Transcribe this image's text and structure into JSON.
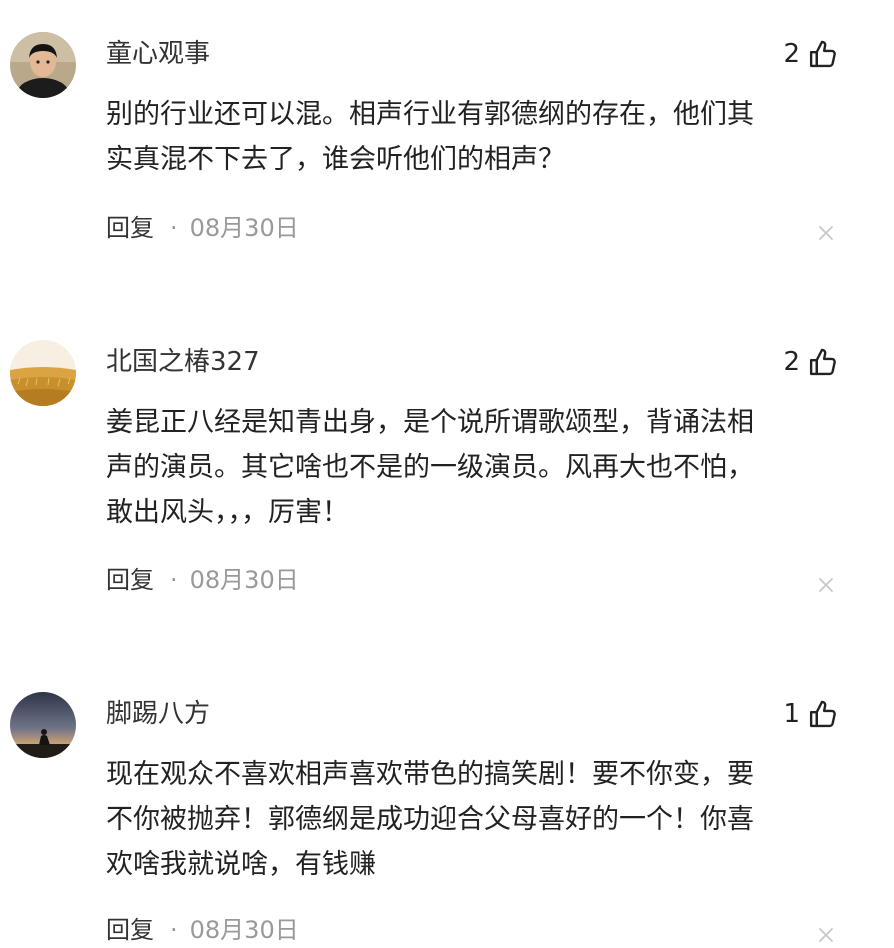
{
  "comments": [
    {
      "username": "童心观事",
      "likes": "2",
      "text_lines": [
        "别的行业还可以混。相声行业有郭德纲的存在，他们其",
        "实真混不下去了，谁会听他们的相声？"
      ],
      "reply_label": "回复",
      "separator": "·",
      "date": "08月30日",
      "avatar_icon": "boy-portrait-avatar"
    },
    {
      "username": "北国之椿327",
      "likes": "2",
      "text_lines": [
        "姜昆正八经是知青出身，是个说所谓歌颂型，背诵法相",
        "声的演员。其它啥也不是的一级演员。风再大也不怕，",
        "敢出风头，，，厉害！"
      ],
      "reply_label": "回复",
      "separator": "·",
      "date": "08月30日",
      "avatar_icon": "wheat-field-avatar"
    },
    {
      "username": "脚踢八方",
      "likes": "1",
      "text_lines": [
        "现在观众不喜欢相声喜欢带色的搞笑剧！要不你变，要",
        "不你被抛弃！郭德纲是成功迎合父母喜好的一个！你喜",
        "欢啥我就说啥，有钱赚"
      ],
      "reply_label": "回复",
      "separator": "·",
      "date": "08月30日",
      "avatar_icon": "sunset-silhouette-avatar"
    }
  ]
}
